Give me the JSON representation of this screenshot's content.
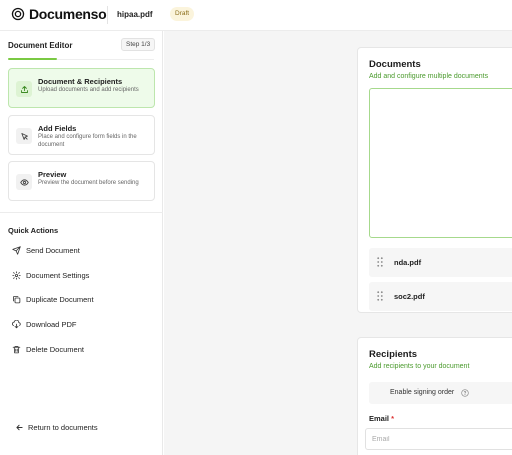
{
  "header": {
    "app_name": "Documenso",
    "file_name": "hipaa.pdf",
    "status_badge": "Draft"
  },
  "sidebar": {
    "title": "Document Editor",
    "step_indicator": "Step 1/3",
    "steps": [
      {
        "title": "Document & Recipients",
        "description": "Upload documents and add recipients",
        "active": true,
        "icon": "upload-icon"
      },
      {
        "title": "Add Fields",
        "description": "Place and configure form fields in the document",
        "active": false,
        "icon": "pointer-icon"
      },
      {
        "title": "Preview",
        "description": "Preview the document before sending",
        "active": false,
        "icon": "eye-icon"
      }
    ],
    "quick_actions_title": "Quick Actions",
    "quick_actions": [
      {
        "label": "Send Document",
        "icon": "send-icon"
      },
      {
        "label": "Document Settings",
        "icon": "gear-icon"
      },
      {
        "label": "Duplicate Document",
        "icon": "duplicate-icon"
      },
      {
        "label": "Download PDF",
        "icon": "download-icon"
      },
      {
        "label": "Delete Document",
        "icon": "trash-icon"
      }
    ],
    "return_label": "Return to documents"
  },
  "documents": {
    "title": "Documents",
    "subtitle": "Add and configure multiple documents",
    "files": [
      "nda.pdf",
      "soc2.pdf"
    ]
  },
  "recipients": {
    "title": "Recipients",
    "subtitle": "Add recipients to your document",
    "signing_order_label": "Enable signing order",
    "email_label": "Email",
    "email_required_mark": "*",
    "email_placeholder": "Email",
    "email_value": ""
  },
  "colors": {
    "accent": "#7ac943",
    "active_step_bg": "#eefbea",
    "subtitle_green": "#4a9a2c",
    "draft_badge_bg": "#fbf4dc"
  }
}
